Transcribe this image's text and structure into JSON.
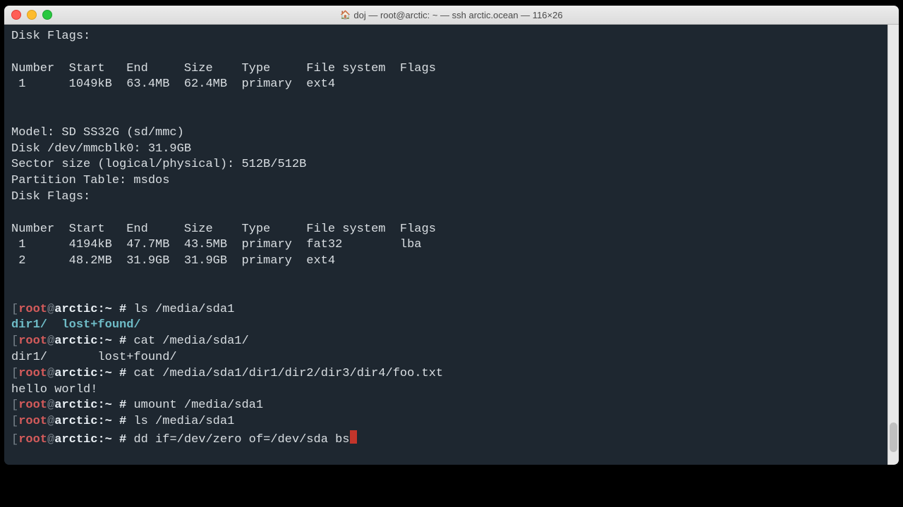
{
  "titlebar": {
    "title": "doj — root@arctic: ~ — ssh arctic.ocean — 116×26"
  },
  "colors": {
    "bg": "#1e2730",
    "fg": "#d9dee2",
    "grey": "#778089",
    "red": "#d45b5b",
    "cyan": "#6fbcc7",
    "cursor": "#c3352b"
  },
  "prompt": {
    "open": "[",
    "user": "root",
    "at": "@",
    "host": "arctic",
    "path": ":~ #",
    "close": "]"
  },
  "lines": {
    "disk_flags1": "Disk Flags:",
    "hdr1": "Number  Start   End     Size    Type     File system  Flags",
    "row1": " 1      1049kB  63.4MB  62.4MB  primary  ext4",
    "model": "Model: SD SS32G (sd/mmc)",
    "disk": "Disk /dev/mmcblk0: 31.9GB",
    "sector": "Sector size (logical/physical): 512B/512B",
    "ptable": "Partition Table: msdos",
    "disk_flags2": "Disk Flags:",
    "hdr2": "Number  Start   End     Size    Type     File system  Flags",
    "row2a": " 1      4194kB  47.7MB  43.5MB  primary  fat32        lba",
    "row2b": " 2      48.2MB  31.9GB  31.9GB  primary  ext4",
    "cmd_ls1": " ls /media/sda1",
    "ls_out1a": "dir1/",
    "ls_out1b": "  lost+found/",
    "cmd_cat1": " cat /media/sda1/",
    "cat1_out": "dir1/       lost+found/",
    "cmd_cat2": " cat /media/sda1/dir1/dir2/dir3/dir4/foo.txt",
    "cat2_out": "hello world!",
    "cmd_umount": " umount /media/sda1",
    "cmd_ls2": " ls /media/sda1",
    "cmd_dd": " dd if=/dev/zero of=/dev/sda bs"
  }
}
